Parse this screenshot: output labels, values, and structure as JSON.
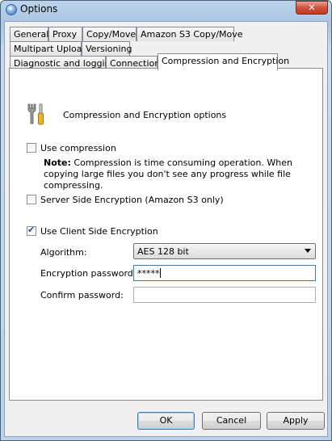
{
  "window": {
    "title": "Options",
    "close_label": "✕"
  },
  "tabs_row1": [
    "General",
    "Proxy",
    "Copy/Move",
    "Amazon S3 Copy/Move"
  ],
  "tabs_row2": [
    "Multipart Upload",
    "Versioning"
  ],
  "tabs_row3": [
    "Diagnostic and logging",
    "Connection",
    "Compression and Encryption"
  ],
  "active_tab": "Compression and Encryption",
  "section": {
    "title": "Compression and Encryption options",
    "icon": "tools-icon"
  },
  "options": {
    "use_compression": {
      "label": "Use compression",
      "checked": false
    },
    "note_prefix": "Note:",
    "note_text": " Compression is time consuming operation. When copying large files you don't see any progress while file compressing.",
    "sse": {
      "label": "Server Side Encryption (Amazon S3 only)",
      "checked": false
    },
    "cse": {
      "label": "Use Client Side Encryption",
      "checked": true
    }
  },
  "fields": {
    "algorithm_label": "Algorithm:",
    "algorithm_value": "AES 128 bit",
    "password_label": "Encryption password:",
    "password_value": "*****",
    "confirm_label": "Confirm password:",
    "confirm_value": ""
  },
  "buttons": {
    "ok": "OK",
    "cancel": "Cancel",
    "apply": "Apply"
  },
  "colors": {
    "title_bar": "#a9c4e2",
    "close_button": "#c13a22",
    "focus_border": "#3d7bad"
  }
}
